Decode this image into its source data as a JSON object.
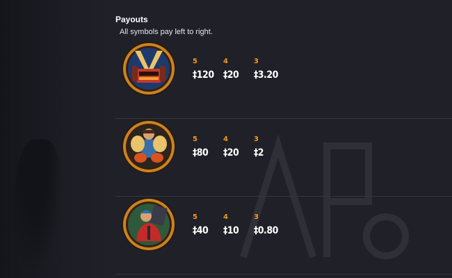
{
  "payouts": {
    "title": "Payouts",
    "subtitle": "All symbols pay left to right.",
    "rows": [
      {
        "symbol_icon": "stage-speaker-symbol-icon",
        "pays": [
          {
            "count": "5",
            "value": "‡120"
          },
          {
            "count": "4",
            "value": "‡20"
          },
          {
            "count": "3",
            "value": "‡3.20"
          }
        ]
      },
      {
        "symbol_icon": "drummer-symbol-icon",
        "pays": [
          {
            "count": "5",
            "value": "‡80"
          },
          {
            "count": "4",
            "value": "‡20"
          },
          {
            "count": "3",
            "value": "‡2"
          }
        ]
      },
      {
        "symbol_icon": "roadie-symbol-icon",
        "pays": [
          {
            "count": "5",
            "value": "‡40"
          },
          {
            "count": "4",
            "value": "‡10"
          },
          {
            "count": "3",
            "value": "‡0.80"
          }
        ]
      }
    ]
  },
  "colors": {
    "background": "#1f2028",
    "count_accent": "#f39a1e",
    "value_text": "#ffffff",
    "divider": "#34353e",
    "medallion_ring": "#c8851f"
  }
}
